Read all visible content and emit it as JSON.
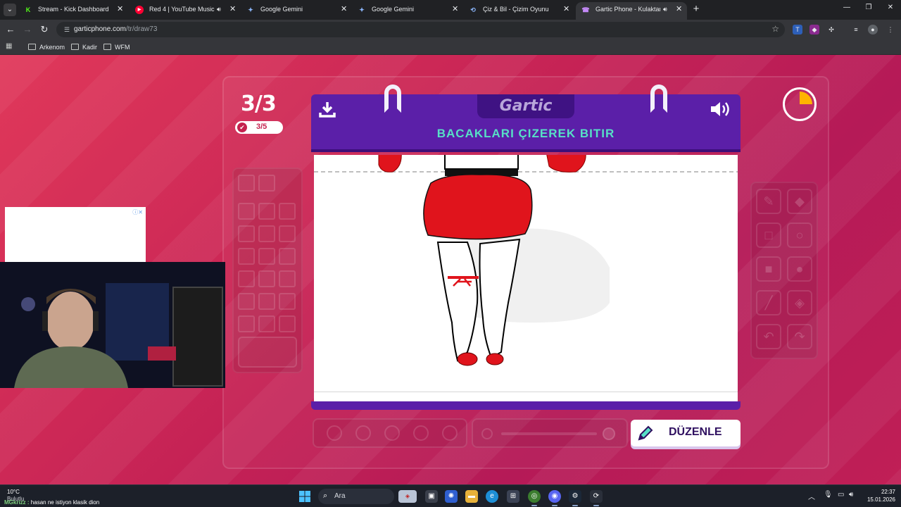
{
  "browser": {
    "tabs": [
      {
        "title": "Stream - Kick Dashboard",
        "favicon": "K",
        "color": "#53fc18"
      },
      {
        "title": "Red 4 | YouTube Music",
        "favicon": "▶",
        "color": "#ff0033"
      },
      {
        "title": "Google Gemini",
        "favicon": "✦",
        "color": "#8ab4f8"
      },
      {
        "title": "Google Gemini",
        "favicon": "✦",
        "color": "#8ab4f8"
      },
      {
        "title": "Çiz & Bil - Çizim Oyunu",
        "favicon": "⟲",
        "color": "#8ab4f8"
      },
      {
        "title": "Gartic Phone - Kulaktan Kul",
        "favicon": "☎",
        "color": "#c58af9"
      }
    ],
    "url_host": "garticphone.com",
    "url_path": "/tr/draw73",
    "bookmarks": [
      "Arkenom",
      "Kadir",
      "WFM"
    ]
  },
  "game": {
    "round": "3/3",
    "done_count": "3/5",
    "brand": "Gartic",
    "prompt": "BACAKLARI ÇIZEREK BITIR",
    "edit_label": "DÜZENLE",
    "timer_fraction_elapsed": 0.25,
    "colors": {
      "accent": "#5b1fa8",
      "prompt": "#57e0c6",
      "timer": "#ffb400",
      "drawing": "#e0141c"
    }
  },
  "overlay": {
    "ad_info": "ⓘ✕"
  },
  "taskbar": {
    "weather_temp": "10°C",
    "weather_cond": "Bulutlu",
    "chat_user": "MGkrizz :",
    "chat_msg": "hasan ne istiyon klasik dion",
    "search_label": "Ara",
    "time": "22:37",
    "date": "15.01.2026"
  }
}
